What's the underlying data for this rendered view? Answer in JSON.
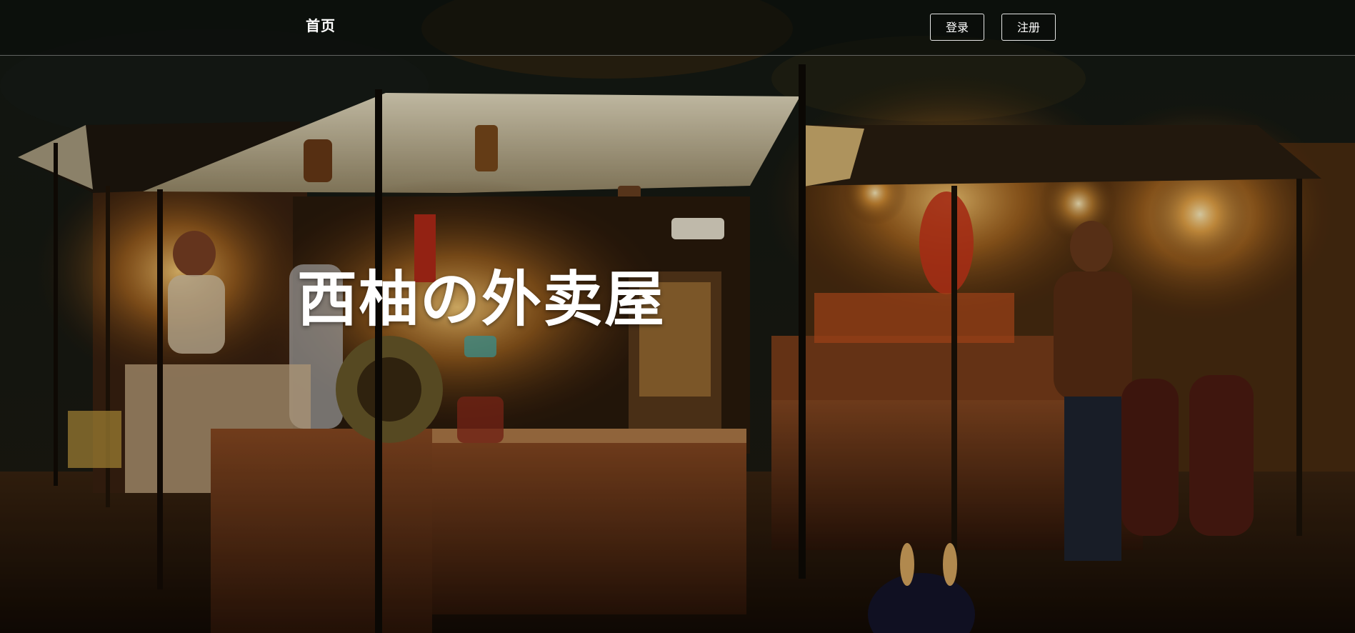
{
  "navbar": {
    "home_label": "首页",
    "login_label": "登录",
    "register_label": "注册"
  },
  "hero": {
    "title": "西柚の外卖屋",
    "background": "night-food-stall-painting"
  },
  "colors": {
    "text": "#ffffff",
    "nav_bg": "#0a0c0a",
    "lantern_glow": "#f2a53a",
    "stall_wood": "#5a2f16"
  }
}
